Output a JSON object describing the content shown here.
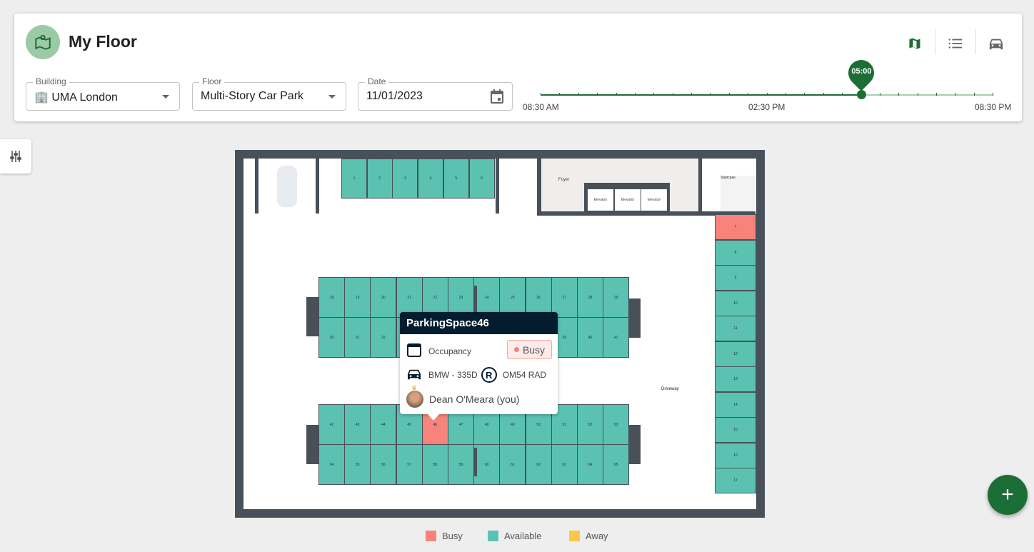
{
  "header": {
    "title": "My Floor",
    "icon": "map-pin-icon"
  },
  "filters": {
    "building": {
      "label": "Building",
      "value": "UMA London"
    },
    "floor": {
      "label": "Floor",
      "value": "Multi-Story Car Park"
    },
    "date": {
      "label": "Date",
      "value": "11/01/2023"
    }
  },
  "views": [
    "map-view-icon",
    "list-view-icon",
    "car-view-icon"
  ],
  "timeline": {
    "start": "08:30 AM",
    "middle": "02:30 PM",
    "end": "08:30 PM",
    "current": "05:00",
    "position": 0.71,
    "ticks": 24
  },
  "floorplan": {
    "labels": {
      "foyer": "Foyer",
      "elevator": "Elevator",
      "staircase": "Staircase",
      "driveway": "Driveway"
    },
    "busy_spots": [
      7,
      46
    ],
    "spot_ranges": {
      "top": [
        1,
        6
      ],
      "right": [
        7,
        17
      ],
      "row1": [
        18,
        29
      ],
      "row2": [
        30,
        41
      ],
      "row3": [
        42,
        53
      ],
      "row4": [
        54,
        65
      ]
    }
  },
  "tooltip": {
    "title": "ParkingSpace46",
    "occupancy_label": "Occupancy",
    "status": "Busy",
    "vehicle": "BMW - 335D",
    "plate": "OM54 RAD",
    "user": "Dean O'Meara (you)"
  },
  "legend": [
    {
      "label": "Busy",
      "color": "#f7837a"
    },
    {
      "label": "Available",
      "color": "#5bc1b1"
    },
    {
      "label": "Away",
      "color": "#fbc748"
    }
  ],
  "colors": {
    "accent": "#1b6e35",
    "available": "#5bc1b1",
    "busy": "#f7837a",
    "away": "#fbc748"
  }
}
